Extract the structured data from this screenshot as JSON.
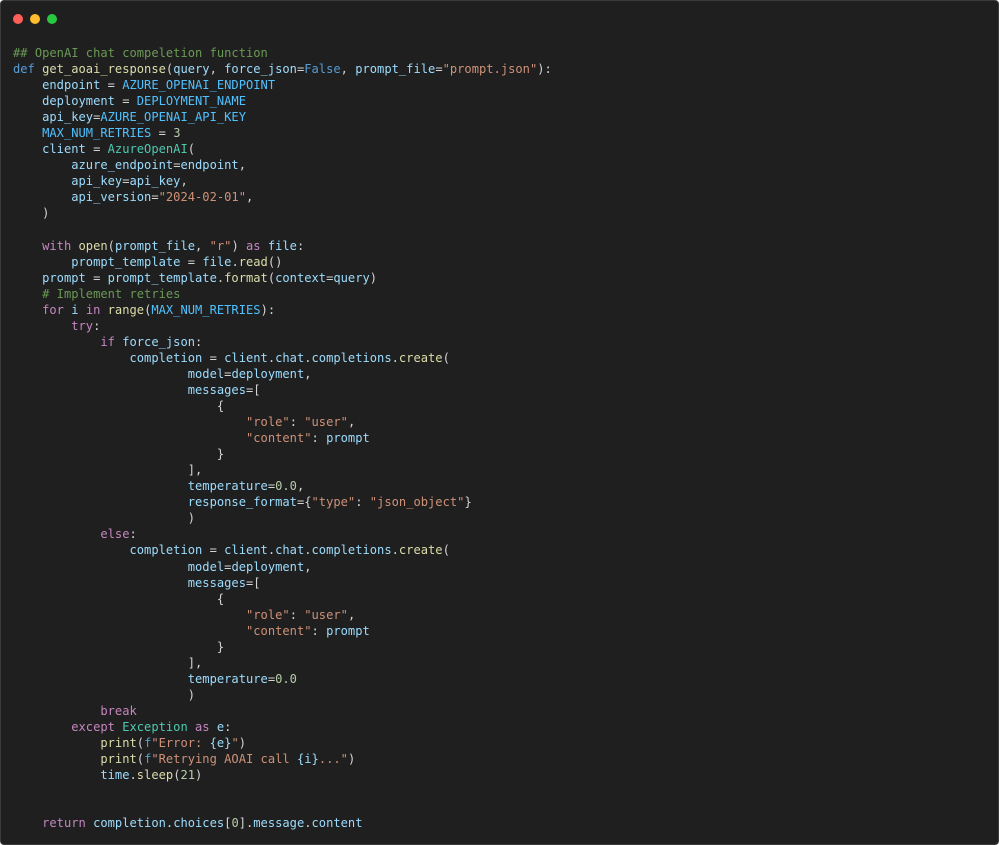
{
  "window": {
    "controls": {
      "close_color": "#ff5f57",
      "minimize_color": "#febc2e",
      "maximize_color": "#28c840"
    }
  },
  "editor": {
    "language": "python",
    "lines": [
      [
        [
          "comment",
          "## OpenAI chat compeletion function"
        ]
      ],
      [
        [
          "def",
          "def "
        ],
        [
          "func",
          "get_aoai_response"
        ],
        [
          "plain",
          "("
        ],
        [
          "var",
          "query"
        ],
        [
          "plain",
          ", "
        ],
        [
          "var",
          "force_json"
        ],
        [
          "plain",
          "="
        ],
        [
          "bool",
          "False"
        ],
        [
          "plain",
          ", "
        ],
        [
          "var",
          "prompt_file"
        ],
        [
          "plain",
          "="
        ],
        [
          "str",
          "\"prompt.json\""
        ],
        [
          "plain",
          "):"
        ]
      ],
      [
        [
          "plain",
          "    "
        ],
        [
          "var",
          "endpoint"
        ],
        [
          "plain",
          " = "
        ],
        [
          "const",
          "AZURE_OPENAI_ENDPOINT"
        ]
      ],
      [
        [
          "plain",
          "    "
        ],
        [
          "var",
          "deployment"
        ],
        [
          "plain",
          " = "
        ],
        [
          "const",
          "DEPLOYMENT_NAME"
        ]
      ],
      [
        [
          "plain",
          "    "
        ],
        [
          "var",
          "api_key"
        ],
        [
          "plain",
          "="
        ],
        [
          "const",
          "AZURE_OPENAI_API_KEY"
        ]
      ],
      [
        [
          "plain",
          "    "
        ],
        [
          "const",
          "MAX_NUM_RETRIES"
        ],
        [
          "plain",
          " = "
        ],
        [
          "num",
          "3"
        ]
      ],
      [
        [
          "plain",
          "    "
        ],
        [
          "var",
          "client"
        ],
        [
          "plain",
          " = "
        ],
        [
          "class",
          "AzureOpenAI"
        ],
        [
          "plain",
          "("
        ]
      ],
      [
        [
          "plain",
          "        "
        ],
        [
          "var",
          "azure_endpoint"
        ],
        [
          "plain",
          "="
        ],
        [
          "var",
          "endpoint"
        ],
        [
          "plain",
          ","
        ]
      ],
      [
        [
          "plain",
          "        "
        ],
        [
          "var",
          "api_key"
        ],
        [
          "plain",
          "="
        ],
        [
          "var",
          "api_key"
        ],
        [
          "plain",
          ","
        ]
      ],
      [
        [
          "plain",
          "        "
        ],
        [
          "var",
          "api_version"
        ],
        [
          "plain",
          "="
        ],
        [
          "str",
          "\"2024-02-01\""
        ],
        [
          "plain",
          ","
        ]
      ],
      [
        [
          "plain",
          "    )"
        ]
      ],
      [
        [
          "plain",
          ""
        ]
      ],
      [
        [
          "plain",
          "    "
        ],
        [
          "keyword",
          "with"
        ],
        [
          "plain",
          " "
        ],
        [
          "func",
          "open"
        ],
        [
          "plain",
          "("
        ],
        [
          "var",
          "prompt_file"
        ],
        [
          "plain",
          ", "
        ],
        [
          "str",
          "\"r\""
        ],
        [
          "plain",
          ") "
        ],
        [
          "keyword",
          "as"
        ],
        [
          "plain",
          " "
        ],
        [
          "var",
          "file"
        ],
        [
          "plain",
          ":"
        ]
      ],
      [
        [
          "plain",
          "        "
        ],
        [
          "var",
          "prompt_template"
        ],
        [
          "plain",
          " = "
        ],
        [
          "var",
          "file"
        ],
        [
          "plain",
          "."
        ],
        [
          "func",
          "read"
        ],
        [
          "plain",
          "()"
        ]
      ],
      [
        [
          "plain",
          "    "
        ],
        [
          "var",
          "prompt"
        ],
        [
          "plain",
          " = "
        ],
        [
          "var",
          "prompt_template"
        ],
        [
          "plain",
          "."
        ],
        [
          "func",
          "format"
        ],
        [
          "plain",
          "("
        ],
        [
          "var",
          "context"
        ],
        [
          "plain",
          "="
        ],
        [
          "var",
          "query"
        ],
        [
          "plain",
          ")"
        ]
      ],
      [
        [
          "plain",
          "    "
        ],
        [
          "comment",
          "# Implement retries"
        ]
      ],
      [
        [
          "plain",
          "    "
        ],
        [
          "keyword",
          "for"
        ],
        [
          "plain",
          " "
        ],
        [
          "var",
          "i"
        ],
        [
          "plain",
          " "
        ],
        [
          "keyword",
          "in"
        ],
        [
          "plain",
          " "
        ],
        [
          "func",
          "range"
        ],
        [
          "plain",
          "("
        ],
        [
          "const",
          "MAX_NUM_RETRIES"
        ],
        [
          "plain",
          "):"
        ]
      ],
      [
        [
          "plain",
          "        "
        ],
        [
          "keyword",
          "try"
        ],
        [
          "plain",
          ":"
        ]
      ],
      [
        [
          "plain",
          "            "
        ],
        [
          "keyword",
          "if"
        ],
        [
          "plain",
          " "
        ],
        [
          "var",
          "force_json"
        ],
        [
          "plain",
          ":"
        ]
      ],
      [
        [
          "plain",
          "                "
        ],
        [
          "var",
          "completion"
        ],
        [
          "plain",
          " = "
        ],
        [
          "var",
          "client"
        ],
        [
          "plain",
          "."
        ],
        [
          "var",
          "chat"
        ],
        [
          "plain",
          "."
        ],
        [
          "var",
          "completions"
        ],
        [
          "plain",
          "."
        ],
        [
          "func",
          "create"
        ],
        [
          "plain",
          "("
        ]
      ],
      [
        [
          "plain",
          "                        "
        ],
        [
          "var",
          "model"
        ],
        [
          "plain",
          "="
        ],
        [
          "var",
          "deployment"
        ],
        [
          "plain",
          ","
        ]
      ],
      [
        [
          "plain",
          "                        "
        ],
        [
          "var",
          "messages"
        ],
        [
          "plain",
          "=["
        ]
      ],
      [
        [
          "plain",
          "                            {"
        ]
      ],
      [
        [
          "plain",
          "                                "
        ],
        [
          "str",
          "\"role\""
        ],
        [
          "plain",
          ": "
        ],
        [
          "str",
          "\"user\""
        ],
        [
          "plain",
          ","
        ]
      ],
      [
        [
          "plain",
          "                                "
        ],
        [
          "str",
          "\"content\""
        ],
        [
          "plain",
          ": "
        ],
        [
          "var",
          "prompt"
        ]
      ],
      [
        [
          "plain",
          "                            }"
        ]
      ],
      [
        [
          "plain",
          "                        ],"
        ]
      ],
      [
        [
          "plain",
          "                        "
        ],
        [
          "var",
          "temperature"
        ],
        [
          "plain",
          "="
        ],
        [
          "num",
          "0.0"
        ],
        [
          "plain",
          ","
        ]
      ],
      [
        [
          "plain",
          "                        "
        ],
        [
          "var",
          "response_format"
        ],
        [
          "plain",
          "={"
        ],
        [
          "str",
          "\"type\""
        ],
        [
          "plain",
          ": "
        ],
        [
          "str",
          "\"json_object\""
        ],
        [
          "plain",
          "}"
        ]
      ],
      [
        [
          "plain",
          "                        )"
        ]
      ],
      [
        [
          "plain",
          "            "
        ],
        [
          "keyword",
          "else"
        ],
        [
          "plain",
          ":"
        ]
      ],
      [
        [
          "plain",
          "                "
        ],
        [
          "var",
          "completion"
        ],
        [
          "plain",
          " = "
        ],
        [
          "var",
          "client"
        ],
        [
          "plain",
          "."
        ],
        [
          "var",
          "chat"
        ],
        [
          "plain",
          "."
        ],
        [
          "var",
          "completions"
        ],
        [
          "plain",
          "."
        ],
        [
          "func",
          "create"
        ],
        [
          "plain",
          "("
        ]
      ],
      [
        [
          "plain",
          "                        "
        ],
        [
          "var",
          "model"
        ],
        [
          "plain",
          "="
        ],
        [
          "var",
          "deployment"
        ],
        [
          "plain",
          ","
        ]
      ],
      [
        [
          "plain",
          "                        "
        ],
        [
          "var",
          "messages"
        ],
        [
          "plain",
          "=["
        ]
      ],
      [
        [
          "plain",
          "                            {"
        ]
      ],
      [
        [
          "plain",
          "                                "
        ],
        [
          "str",
          "\"role\""
        ],
        [
          "plain",
          ": "
        ],
        [
          "str",
          "\"user\""
        ],
        [
          "plain",
          ","
        ]
      ],
      [
        [
          "plain",
          "                                "
        ],
        [
          "str",
          "\"content\""
        ],
        [
          "plain",
          ": "
        ],
        [
          "var",
          "prompt"
        ]
      ],
      [
        [
          "plain",
          "                            }"
        ]
      ],
      [
        [
          "plain",
          "                        ],"
        ]
      ],
      [
        [
          "plain",
          "                        "
        ],
        [
          "var",
          "temperature"
        ],
        [
          "plain",
          "="
        ],
        [
          "num",
          "0.0"
        ]
      ],
      [
        [
          "plain",
          "                        )"
        ]
      ],
      [
        [
          "plain",
          "            "
        ],
        [
          "keyword",
          "break"
        ]
      ],
      [
        [
          "plain",
          "        "
        ],
        [
          "keyword",
          "except"
        ],
        [
          "plain",
          " "
        ],
        [
          "class",
          "Exception"
        ],
        [
          "plain",
          " "
        ],
        [
          "keyword",
          "as"
        ],
        [
          "plain",
          " "
        ],
        [
          "var",
          "e"
        ],
        [
          "plain",
          ":"
        ]
      ],
      [
        [
          "plain",
          "            "
        ],
        [
          "func",
          "print"
        ],
        [
          "plain",
          "("
        ],
        [
          "def",
          "f"
        ],
        [
          "str",
          "\"Error: "
        ],
        [
          "var",
          "{e}"
        ],
        [
          "str",
          "\""
        ],
        [
          "plain",
          ")"
        ]
      ],
      [
        [
          "plain",
          "            "
        ],
        [
          "func",
          "print"
        ],
        [
          "plain",
          "("
        ],
        [
          "def",
          "f"
        ],
        [
          "str",
          "\"Retrying AOAI call "
        ],
        [
          "var",
          "{i}"
        ],
        [
          "str",
          "...\""
        ],
        [
          "plain",
          ")"
        ]
      ],
      [
        [
          "plain",
          "            "
        ],
        [
          "var",
          "time"
        ],
        [
          "plain",
          "."
        ],
        [
          "func",
          "sleep"
        ],
        [
          "plain",
          "("
        ],
        [
          "num",
          "21"
        ],
        [
          "plain",
          ")"
        ]
      ],
      [
        [
          "plain",
          ""
        ]
      ],
      [
        [
          "plain",
          ""
        ]
      ],
      [
        [
          "plain",
          "    "
        ],
        [
          "keyword",
          "return"
        ],
        [
          "plain",
          " "
        ],
        [
          "var",
          "completion"
        ],
        [
          "plain",
          "."
        ],
        [
          "var",
          "choices"
        ],
        [
          "plain",
          "["
        ],
        [
          "num",
          "0"
        ],
        [
          "plain",
          "]."
        ],
        [
          "var",
          "message"
        ],
        [
          "plain",
          "."
        ],
        [
          "var",
          "content"
        ]
      ]
    ]
  }
}
